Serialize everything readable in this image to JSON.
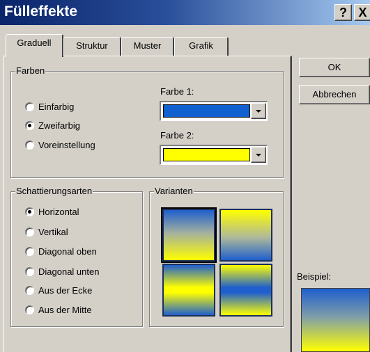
{
  "window": {
    "title": "Fülleffekte",
    "help_label": "?",
    "close_label": "X"
  },
  "tabs": [
    {
      "label": "Graduell",
      "active": true
    },
    {
      "label": "Struktur",
      "active": false
    },
    {
      "label": "Muster",
      "active": false
    },
    {
      "label": "Grafik",
      "active": false
    }
  ],
  "colors_group": {
    "label": "Farben",
    "options": [
      {
        "label": "Einfarbig",
        "checked": false
      },
      {
        "label": "Zweifarbig",
        "checked": true
      },
      {
        "label": "Voreinstellung",
        "checked": false
      }
    ],
    "color1_label": "Farbe 1:",
    "color1_value": "#1060d0",
    "color2_label": "Farbe 2:",
    "color2_value": "#ffff00"
  },
  "shading_group": {
    "label": "Schattierungsarten",
    "options": [
      {
        "label": "Horizontal",
        "checked": true
      },
      {
        "label": "Vertikal",
        "checked": false
      },
      {
        "label": "Diagonal oben",
        "checked": false
      },
      {
        "label": "Diagonal unten",
        "checked": false
      },
      {
        "label": "Aus der Ecke",
        "checked": false
      },
      {
        "label": "Aus der Mitte",
        "checked": false
      }
    ]
  },
  "variants_group": {
    "label": "Varianten",
    "selected_index": 0
  },
  "buttons": {
    "ok_label": "OK",
    "cancel_label": "Abbrechen"
  },
  "preview": {
    "label": "Beispiel:"
  }
}
